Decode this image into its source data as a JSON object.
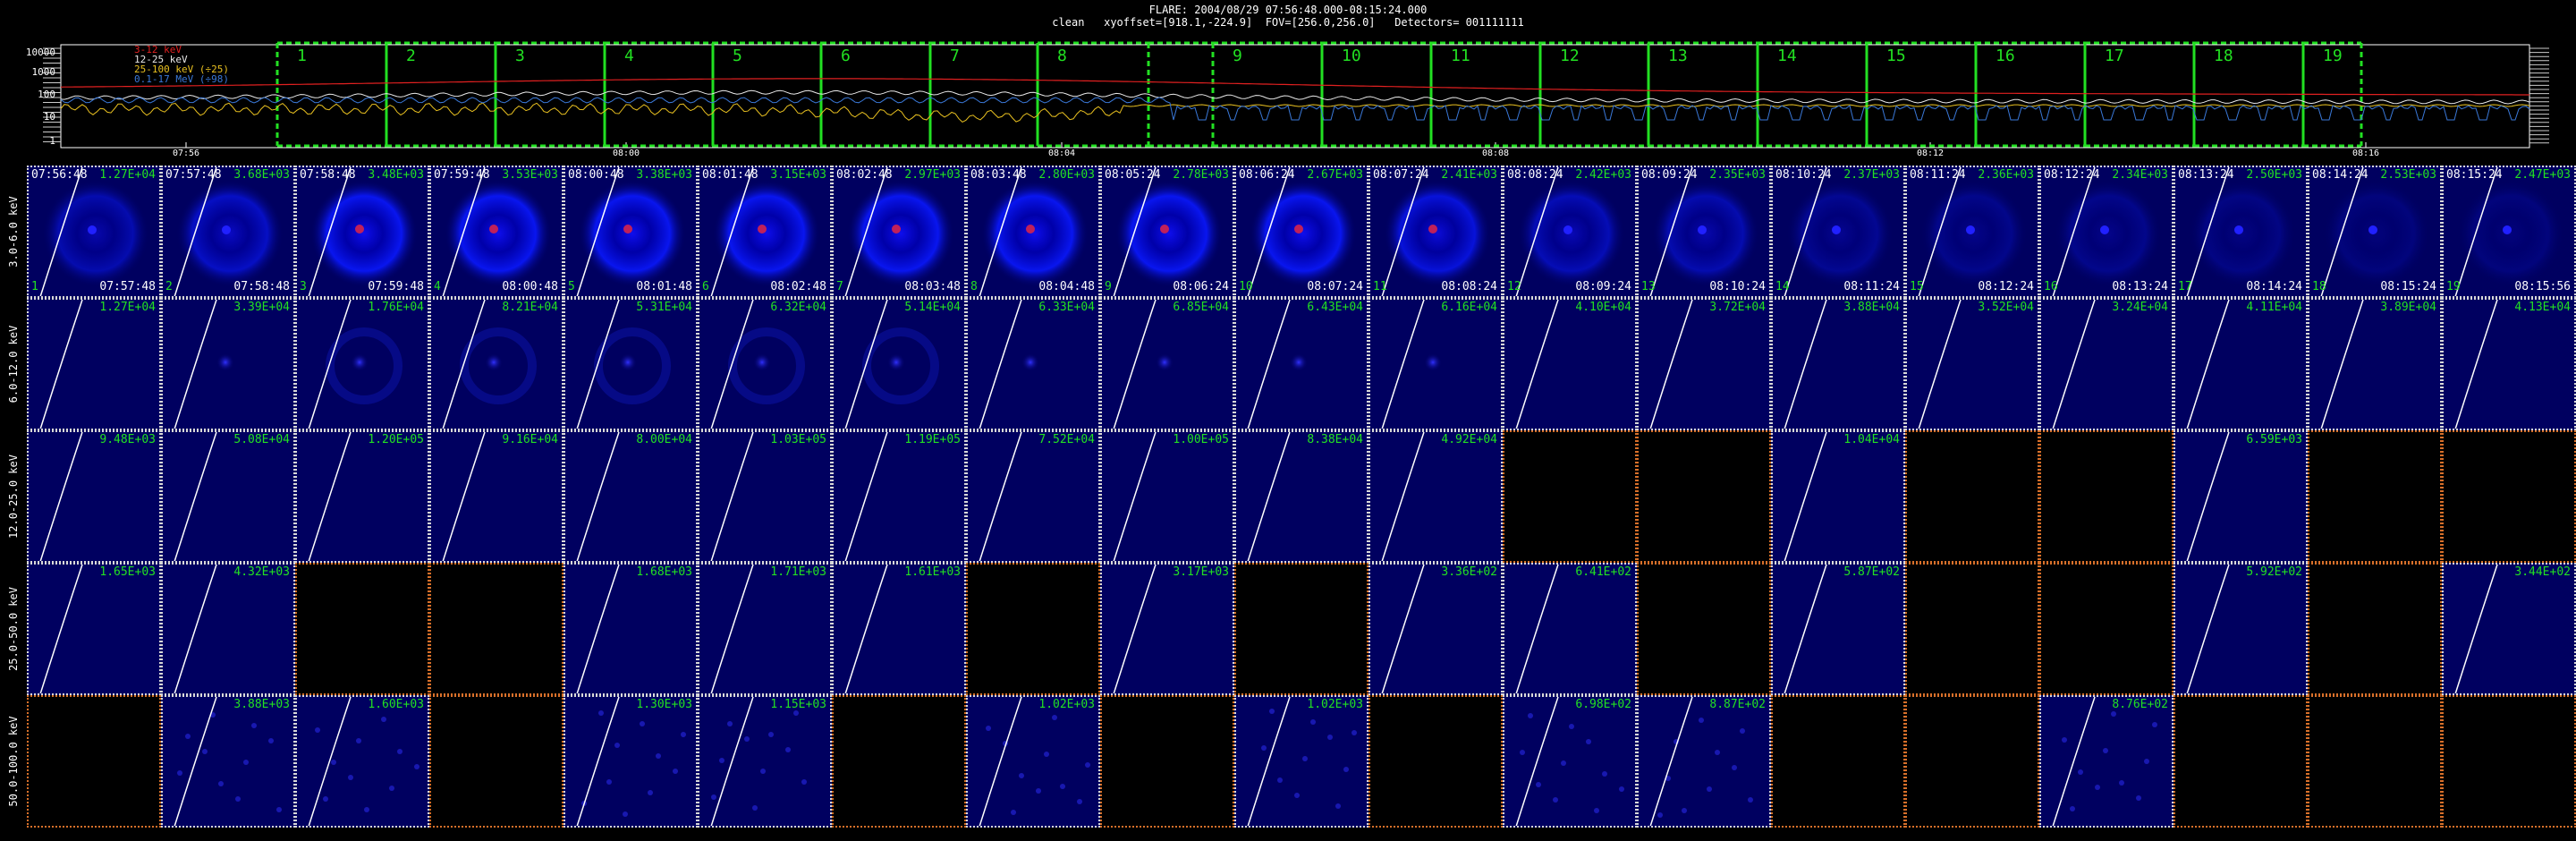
{
  "header": {
    "line1": "FLARE: 2004/08/29 07:56:48.000-08:15:24.000",
    "line2": "clean   xyoffset=[918.1,-224.9]  FOV=[256.0,256.0]   Detectors= 001111111"
  },
  "lightcurve": {
    "y_ticks": [
      "10000",
      "1000",
      "100",
      "10",
      "1"
    ],
    "x_ticks": [
      "07:56",
      "08:00",
      "08:04",
      "08:08",
      "08:12",
      "08:16"
    ],
    "legend": [
      {
        "label": "3-12 keV",
        "color": "#e02020"
      },
      {
        "label": "12-25 keV",
        "color": "#e8e8e8"
      },
      {
        "label": "25-100 keV (÷25)",
        "color": "#e8c020"
      },
      {
        "label": "0.1-17 MeV (÷98)",
        "color": "#3a78d8"
      }
    ],
    "interval_labels": [
      "1",
      "2",
      "3",
      "4",
      "5",
      "6",
      "7",
      "8",
      "",
      "9",
      "10",
      "11",
      "12",
      "13",
      "14",
      "15",
      "16",
      "17",
      "18",
      "19"
    ],
    "accent": "#22e022"
  },
  "energy_bands": [
    "3.0-6.0 keV",
    "6.0-12.0 keV",
    "12.0-25.0 keV",
    "25.0-50.0 keV",
    "50.0-100.0 keV"
  ],
  "time_starts": [
    "07:56:48",
    "07:57:48",
    "07:58:48",
    "07:59:48",
    "08:00:48",
    "08:01:48",
    "08:02:48",
    "08:03:48",
    "08:05:24",
    "08:06:24",
    "08:07:24",
    "08:08:24",
    "08:09:24",
    "08:10:24",
    "08:11:24",
    "08:12:24",
    "08:13:24",
    "08:14:24",
    "08:15:24"
  ],
  "time_ends": [
    "07:57:48",
    "07:58:48",
    "07:59:48",
    "08:00:48",
    "08:01:48",
    "08:02:48",
    "08:03:48",
    "08:04:48",
    "08:06:24",
    "08:07:24",
    "08:08:24",
    "08:09:24",
    "08:10:24",
    "08:11:24",
    "08:12:24",
    "08:13:24",
    "08:14:24",
    "08:15:24",
    "08:15:56"
  ],
  "maxima": [
    [
      "1.27E+04",
      "3.68E+03",
      "3.48E+03",
      "3.53E+03",
      "3.38E+03",
      "3.15E+03",
      "2.97E+03",
      "2.80E+03",
      "2.78E+03",
      "2.67E+03",
      "2.41E+03",
      "2.42E+03",
      "2.35E+03",
      "2.37E+03",
      "2.36E+03",
      "2.34E+03",
      "2.50E+03",
      "2.53E+03",
      "2.47E+03"
    ],
    [
      "1.27E+04",
      "3.39E+04",
      "1.76E+04",
      "8.21E+04",
      "5.31E+04",
      "6.32E+04",
      "5.14E+04",
      "6.33E+04",
      "6.85E+04",
      "6.43E+04",
      "6.16E+04",
      "4.10E+04",
      "3.72E+04",
      "3.88E+04",
      "3.52E+04",
      "3.24E+04",
      "4.11E+04",
      "3.89E+04",
      "4.13E+04"
    ],
    [
      "9.48E+03",
      "5.08E+04",
      "1.20E+05",
      "9.16E+04",
      "8.00E+04",
      "1.03E+05",
      "1.19E+05",
      "7.52E+04",
      "1.00E+05",
      "8.38E+04",
      "4.92E+04",
      "",
      "",
      "1.04E+04",
      "",
      "",
      "6.59E+03",
      "",
      ""
    ],
    [
      "1.65E+03",
      "4.32E+03",
      "",
      "",
      "1.68E+03",
      "1.71E+03",
      "1.61E+03",
      "",
      "3.17E+03",
      "",
      "3.36E+02",
      "6.41E+02",
      "",
      "5.87E+02",
      "",
      "",
      "5.92E+02",
      "",
      "3.44E+02"
    ],
    [
      "",
      "3.88E+03",
      "1.60E+03",
      "",
      "1.30E+03",
      "1.15E+03",
      "",
      "1.02E+03",
      "",
      "1.02E+03",
      "",
      "6.98E+02",
      "8.87E+02",
      "",
      "",
      "8.76E+02",
      "",
      "",
      ""
    ]
  ]
}
